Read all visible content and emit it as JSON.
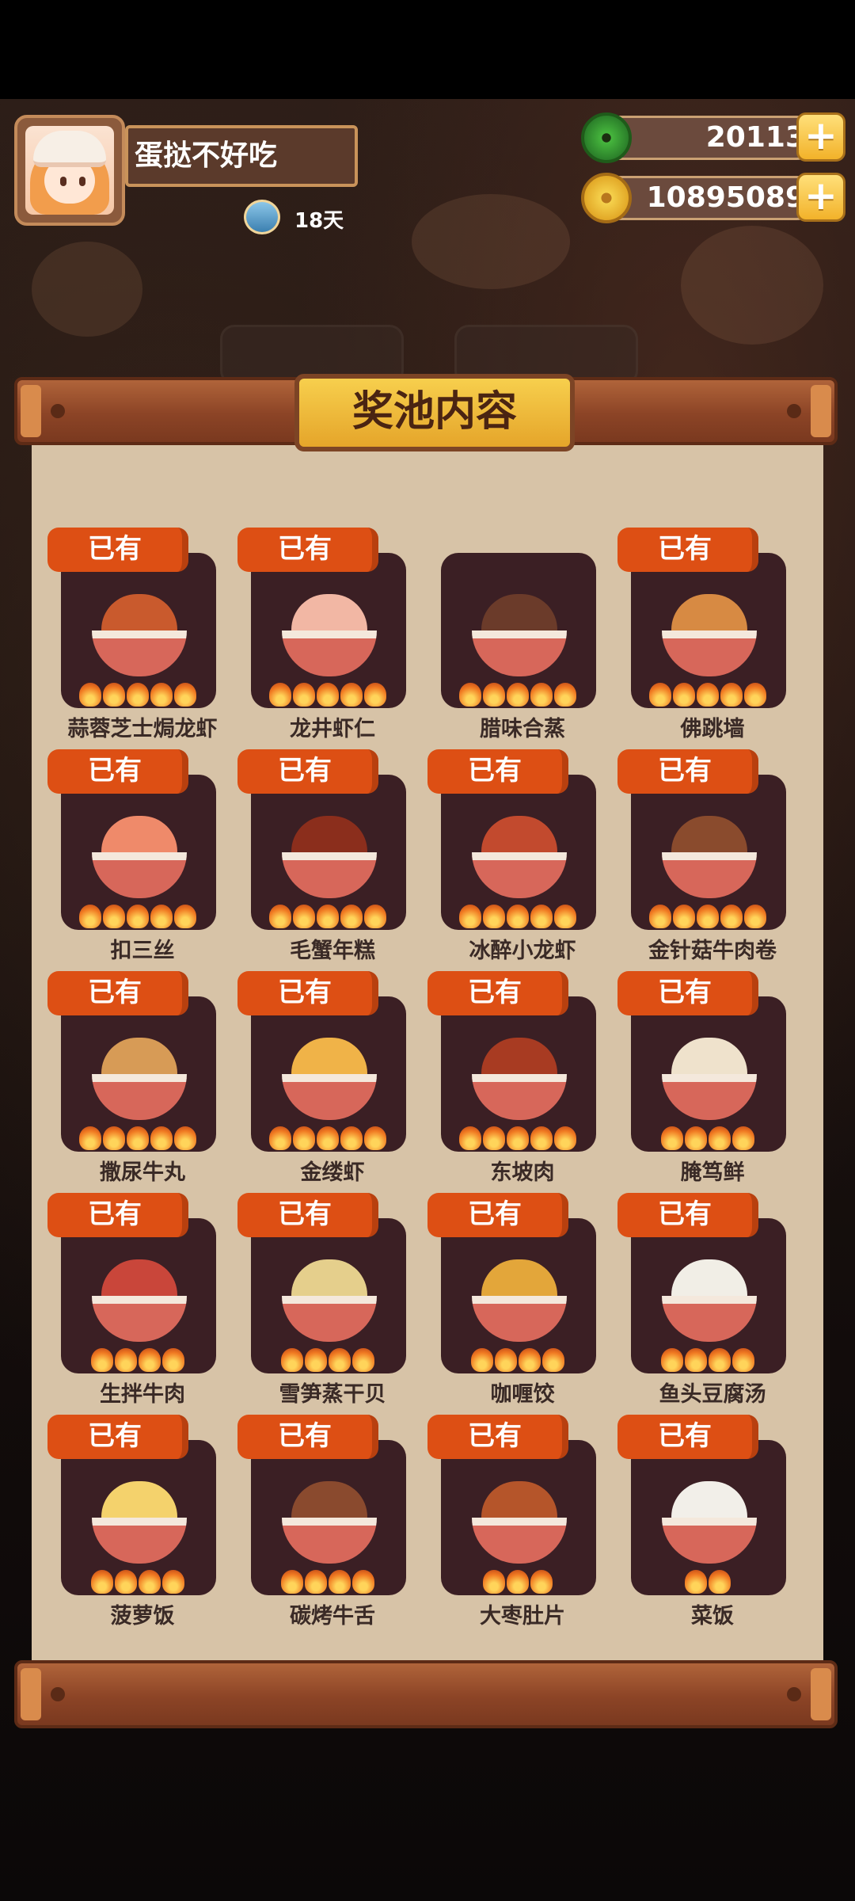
{
  "profile": {
    "name": "蛋挞不好吃",
    "days": "18天"
  },
  "currencies": {
    "jade": "20113",
    "coins": "10895089",
    "plus": "+"
  },
  "panel": {
    "title": "奖池内容",
    "owned_label": "已有"
  },
  "dishes": [
    {
      "name": "蒜蓉芝士焗龙虾",
      "owned": true,
      "stars": 5,
      "color": "#c95a2d"
    },
    {
      "name": "龙井虾仁",
      "owned": true,
      "stars": 5,
      "color": "#f2b7a4"
    },
    {
      "name": "腊味合蒸",
      "owned": false,
      "stars": 5,
      "color": "#6b3b2a"
    },
    {
      "name": "佛跳墙",
      "owned": true,
      "stars": 5,
      "color": "#d78a43"
    },
    {
      "name": "扣三丝",
      "owned": true,
      "stars": 5,
      "color": "#ef8a6a"
    },
    {
      "name": "毛蟹年糕",
      "owned": true,
      "stars": 5,
      "color": "#8b2e1c"
    },
    {
      "name": "冰醉小龙虾",
      "owned": true,
      "stars": 5,
      "color": "#c24a2e"
    },
    {
      "name": "金针菇牛肉卷",
      "owned": true,
      "stars": 5,
      "color": "#8a4b2d"
    },
    {
      "name": "撒尿牛丸",
      "owned": true,
      "stars": 5,
      "color": "#d79b56"
    },
    {
      "name": "金缕虾",
      "owned": true,
      "stars": 5,
      "color": "#f0b348"
    },
    {
      "name": "东坡肉",
      "owned": true,
      "stars": 5,
      "color": "#a83b22"
    },
    {
      "name": "腌笃鲜",
      "owned": true,
      "stars": 4,
      "color": "#efe2cc"
    },
    {
      "name": "生拌牛肉",
      "owned": true,
      "stars": 4,
      "color": "#c9463a"
    },
    {
      "name": "雪笋蒸干贝",
      "owned": true,
      "stars": 4,
      "color": "#e5cf8c"
    },
    {
      "name": "咖喱饺",
      "owned": true,
      "stars": 4,
      "color": "#e3a63a"
    },
    {
      "name": "鱼头豆腐汤",
      "owned": true,
      "stars": 4,
      "color": "#f1eee6"
    },
    {
      "name": "菠萝饭",
      "owned": true,
      "stars": 4,
      "color": "#f4d26c"
    },
    {
      "name": "碳烤牛舌",
      "owned": true,
      "stars": 4,
      "color": "#8a4a2e"
    },
    {
      "name": "大枣肚片",
      "owned": true,
      "stars": 3,
      "color": "#b5552a"
    },
    {
      "name": "菜饭",
      "owned": true,
      "stars": 2,
      "color": "#f2efe9"
    }
  ]
}
